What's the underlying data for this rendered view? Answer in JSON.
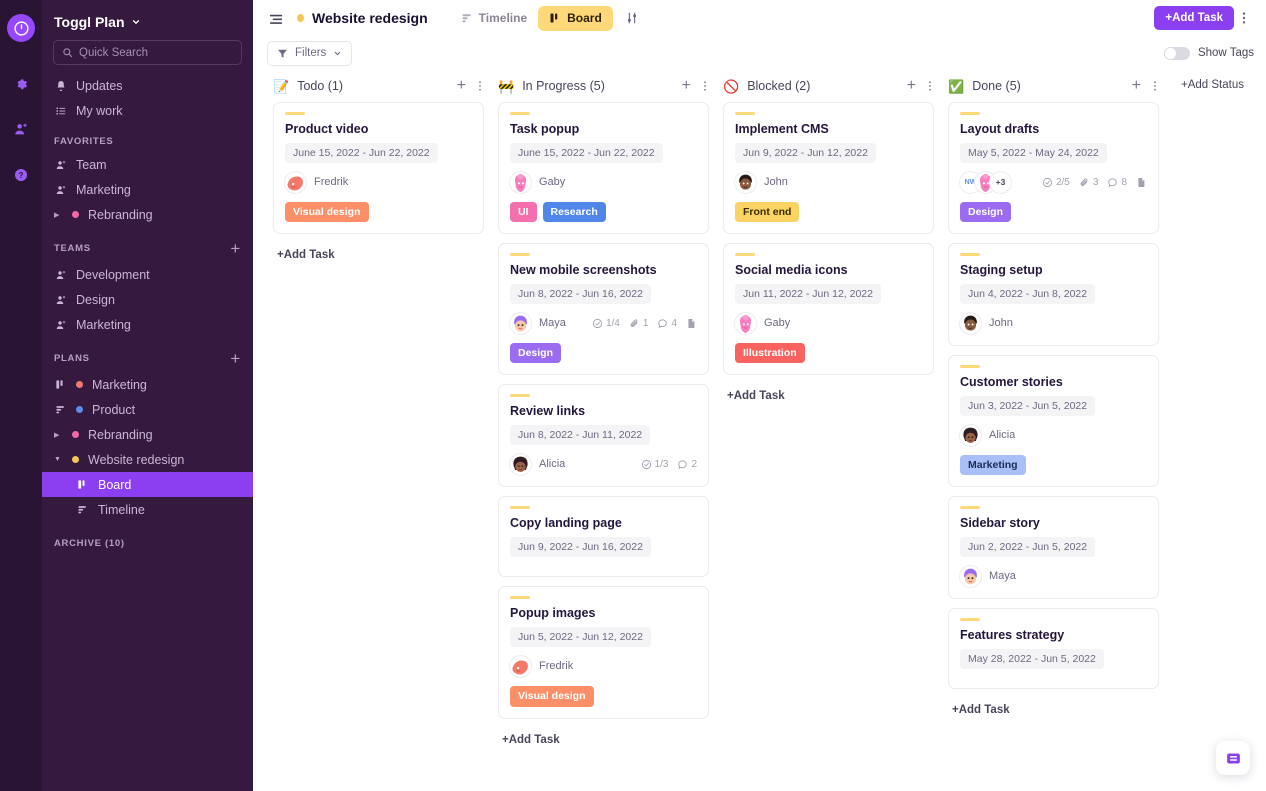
{
  "rail": {
    "logo": "toggl-logo",
    "icons": [
      {
        "name": "gear-icon"
      },
      {
        "name": "invite-user-icon"
      },
      {
        "name": "help-icon"
      }
    ]
  },
  "sidebar": {
    "workspace": "Toggl Plan",
    "search_placeholder": "Quick Search",
    "nav": [
      {
        "label": "Updates",
        "icon": "bell-icon"
      },
      {
        "label": "My work",
        "icon": "list-icon"
      }
    ],
    "favorites_title": "FAVORITES",
    "favorites": [
      {
        "label": "Team",
        "icon": "team-icon"
      },
      {
        "label": "Marketing",
        "icon": "team-icon"
      },
      {
        "label": "Rebranding",
        "icon": "caret-icon",
        "dot": "#f06aa8"
      }
    ],
    "teams_title": "TEAMS",
    "teams": [
      {
        "label": "Development",
        "icon": "team-icon"
      },
      {
        "label": "Design",
        "icon": "team-icon"
      },
      {
        "label": "Marketing",
        "icon": "team-icon"
      }
    ],
    "plans_title": "PLANS",
    "plans": [
      {
        "label": "Marketing",
        "icon": "board-icon",
        "dot": "#f4796b"
      },
      {
        "label": "Product",
        "icon": "timeline-icon",
        "dot": "#5b8def"
      },
      {
        "label": "Rebranding",
        "icon": "caret-icon",
        "dot": "#f06aa8"
      },
      {
        "label": "Website redesign",
        "icon": "caret-down-icon",
        "dot": "#f5c651"
      }
    ],
    "plan_children": [
      {
        "label": "Board",
        "icon": "board-icon",
        "selected": true
      },
      {
        "label": "Timeline",
        "icon": "timeline-icon",
        "selected": false
      }
    ],
    "archive": "ARCHIVE (10)"
  },
  "topbar": {
    "menu_icon": "hamburger-icon",
    "plan_name": "Website redesign",
    "plan_dot": "#f5c651",
    "views": [
      {
        "label": "Timeline",
        "icon": "timeline-icon",
        "active": false
      },
      {
        "label": "Board",
        "icon": "board-icon",
        "active": true
      }
    ],
    "sort_icon": "sort-sliders-icon",
    "add_task_label": "+Add Task",
    "kebab_icon": "more-vertical-icon"
  },
  "subbar": {
    "filters_label": "Filters",
    "filter_icon": "funnel-icon",
    "chevron_icon": "chevron-down-icon",
    "show_tags_label": "Show Tags",
    "show_tags_on": false
  },
  "board": {
    "add_status_label": "+Add Status",
    "add_task_label": "+Add Task",
    "columns": [
      {
        "emoji": "📝",
        "emoji_name": "memo-icon",
        "title": "Todo (1)",
        "cards": [
          {
            "title": "Product video",
            "dates": "June 15, 2022 - Jun 22, 2022",
            "assignees": [
              {
                "name": "Fredrik",
                "style": "fredrik"
              }
            ],
            "assignee_label": "Fredrik",
            "tags": [
              {
                "label": "Visual design",
                "color": "#fa8f68"
              }
            ],
            "meta": []
          }
        ]
      },
      {
        "emoji": "🚧",
        "emoji_name": "construction-icon",
        "title": "In Progress (5)",
        "cards": [
          {
            "title": "Task popup",
            "dates": "June 15, 2022 - Jun 22, 2022",
            "assignees": [
              {
                "name": "Gaby",
                "style": "gaby"
              }
            ],
            "assignee_label": "Gaby",
            "tags": [
              {
                "label": "UI",
                "color": "#f36fae"
              },
              {
                "label": "Research",
                "color": "#4f86e8"
              }
            ],
            "meta": []
          },
          {
            "title": "New mobile screenshots",
            "dates": "Jun 8, 2022 - Jun 16, 2022",
            "assignees": [
              {
                "name": "Maya",
                "style": "maya"
              }
            ],
            "assignee_label": "Maya",
            "tags": [
              {
                "label": "Design",
                "color": "#9b6cf2"
              }
            ],
            "meta": [
              {
                "icon": "checklist-icon",
                "value": "1/4"
              },
              {
                "icon": "attachment-icon",
                "value": "1"
              },
              {
                "icon": "comment-icon",
                "value": "4"
              },
              {
                "icon": "description-icon",
                "value": ""
              }
            ]
          },
          {
            "title": "Review links",
            "dates": "Jun 8, 2022 - Jun 11, 2022",
            "assignees": [
              {
                "name": "Alicia",
                "style": "alicia"
              }
            ],
            "assignee_label": "Alicia",
            "tags": [],
            "meta": [
              {
                "icon": "checklist-icon",
                "value": "1/3"
              },
              {
                "icon": "comment-icon",
                "value": "2"
              }
            ]
          },
          {
            "title": "Copy landing page",
            "dates": "Jun 9, 2022 - Jun 16, 2022",
            "assignees": [],
            "assignee_label": "",
            "tags": [],
            "meta": []
          },
          {
            "title": "Popup images",
            "dates": "Jun 5, 2022 - Jun 12, 2022",
            "assignees": [
              {
                "name": "Fredrik",
                "style": "fredrik"
              }
            ],
            "assignee_label": "Fredrik",
            "tags": [
              {
                "label": "Visual design",
                "color": "#fa8f68"
              }
            ],
            "meta": []
          }
        ]
      },
      {
        "emoji": "🚫",
        "emoji_name": "blocked-icon",
        "title": "Blocked (2)",
        "cards": [
          {
            "title": "Implement CMS",
            "dates": "Jun 9, 2022 - Jun 12, 2022",
            "assignees": [
              {
                "name": "John",
                "style": "john"
              }
            ],
            "assignee_label": "John",
            "tags": [
              {
                "label": "Front end",
                "color": "#fbd365",
                "text": "#3a2d00"
              }
            ],
            "meta": []
          },
          {
            "title": "Social media icons",
            "dates": "Jun 11, 2022 - Jun 12, 2022",
            "assignees": [
              {
                "name": "Gaby",
                "style": "gaby"
              }
            ],
            "assignee_label": "Gaby",
            "tags": [
              {
                "label": "Illustration",
                "color": "#f9625e"
              }
            ],
            "meta": []
          }
        ]
      },
      {
        "emoji": "✅",
        "emoji_name": "check-icon",
        "title": "Done (5)",
        "cards": [
          {
            "title": "Layout drafts",
            "dates": "May 5, 2022 - May 24, 2022",
            "assignees": [
              {
                "name": "NW",
                "style": "initials"
              },
              {
                "name": "Gaby",
                "style": "gaby"
              },
              {
                "name": "+3",
                "style": "more"
              }
            ],
            "assignee_label": "",
            "tags": [
              {
                "label": "Design",
                "color": "#9b6cf2"
              }
            ],
            "meta": [
              {
                "icon": "checklist-icon",
                "value": "2/5"
              },
              {
                "icon": "attachment-icon",
                "value": "3"
              },
              {
                "icon": "comment-icon",
                "value": "8"
              },
              {
                "icon": "description-icon",
                "value": ""
              }
            ]
          },
          {
            "title": "Staging setup",
            "dates": "Jun 4, 2022 - Jun 8, 2022",
            "assignees": [
              {
                "name": "John",
                "style": "john"
              }
            ],
            "assignee_label": "John",
            "tags": [],
            "meta": []
          },
          {
            "title": "Customer stories",
            "dates": "Jun 3, 2022 - Jun 5, 2022",
            "assignees": [
              {
                "name": "Alicia",
                "style": "alicia"
              }
            ],
            "assignee_label": "Alicia",
            "tags": [
              {
                "label": "Marketing",
                "color": "#a8c0f7",
                "text": "#1b2c56"
              }
            ],
            "meta": []
          },
          {
            "title": "Sidebar story",
            "dates": "Jun 2, 2022 - Jun 5, 2022",
            "assignees": [
              {
                "name": "Maya",
                "style": "maya"
              }
            ],
            "assignee_label": "Maya",
            "tags": [],
            "meta": []
          },
          {
            "title": "Features strategy",
            "dates": "May 28, 2022 - Jun 5, 2022",
            "assignees": [],
            "assignee_label": "",
            "tags": [],
            "meta": []
          }
        ]
      }
    ]
  },
  "chat_button": {
    "icon": "chat-widget-icon"
  }
}
